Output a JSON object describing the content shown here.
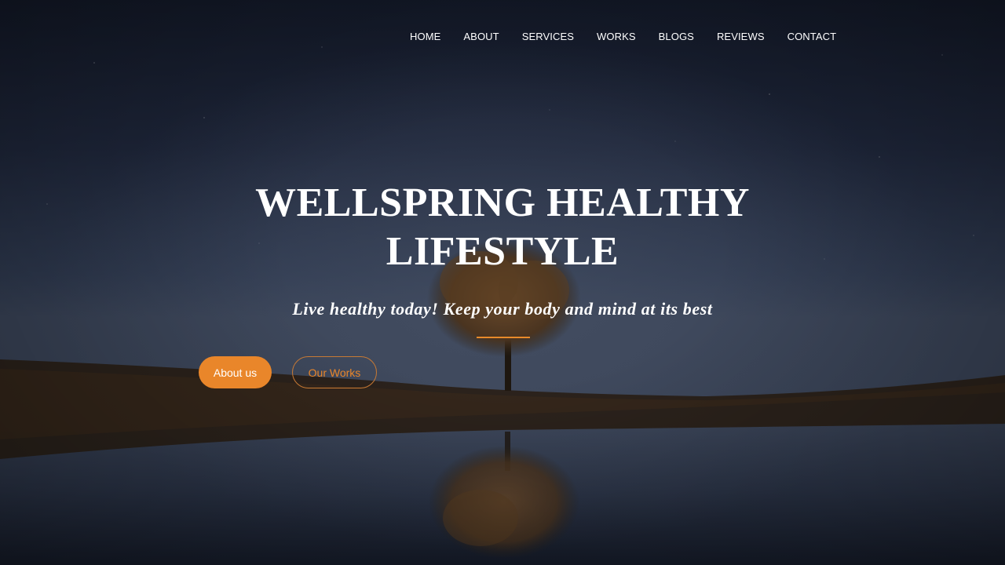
{
  "nav": {
    "items": [
      {
        "label": "HOME"
      },
      {
        "label": "ABOUT"
      },
      {
        "label": "SERVICES"
      },
      {
        "label": "WORKS"
      },
      {
        "label": "BLOGS"
      },
      {
        "label": "REVIEWS"
      },
      {
        "label": "CONTACT"
      }
    ]
  },
  "hero": {
    "title": "WELLSPRING HEALTHY LIFESTYLE",
    "subtitle": "Live healthy today! Keep your body and mind at its best",
    "primary_button": "About us",
    "secondary_button": "Our Works",
    "background_icon": "night-lake-tree-image"
  },
  "colors": {
    "accent": "#e9862a",
    "text": "#ffffff",
    "sky_top": "#141a28",
    "sky_mid": "#2a3448"
  }
}
